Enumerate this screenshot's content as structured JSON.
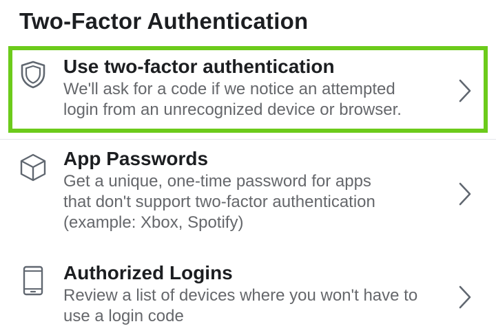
{
  "page": {
    "title": "Two-Factor Authentication"
  },
  "items": [
    {
      "icon": "shield-icon",
      "title": "Use two-factor authentication",
      "desc_lines": [
        "We'll ask for a code if we notice an attempted",
        "login from an unrecognized device or browser."
      ],
      "highlighted": true
    },
    {
      "icon": "cube-icon",
      "title": "App Passwords",
      "desc_lines": [
        "Get a unique, one-time password for apps",
        "that don't support two-factor authentication",
        "(example: Xbox, Spotify)"
      ],
      "highlighted": false
    },
    {
      "icon": "phone-icon",
      "title": "Authorized Logins",
      "desc_lines": [
        "Review a list of devices where you won't have to",
        "use a login code"
      ],
      "highlighted": false
    }
  ],
  "colors": {
    "highlight": "#6ccb1b",
    "title_text": "#1c1e21",
    "secondary_text": "#65676b",
    "icon": "#606770"
  }
}
